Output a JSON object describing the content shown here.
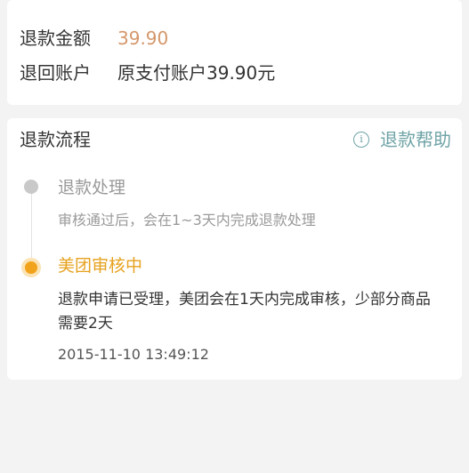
{
  "refund": {
    "amount_label": "退款金额",
    "amount_value": "39.90",
    "account_label": "退回账户",
    "account_value": "原支付账户39.90元"
  },
  "flow": {
    "title": "退款流程",
    "help_label": "退款帮助",
    "help_icon": "info-circle-icon",
    "steps": [
      {
        "title": "退款处理",
        "desc": "审核通过后，会在1~3天内完成退款处理",
        "status": "pending",
        "color": "#c9c9c9"
      },
      {
        "title": "美团审核中",
        "desc": "退款申请已受理，美团会在1天内完成审核，少部分商品需要2天",
        "time": "2015-11-10 13:49:12",
        "status": "active",
        "color": "#f2a31c"
      }
    ]
  },
  "colors": {
    "accent": "#f2a31c",
    "amount": "#d4976a",
    "help": "#6fa3a6"
  }
}
